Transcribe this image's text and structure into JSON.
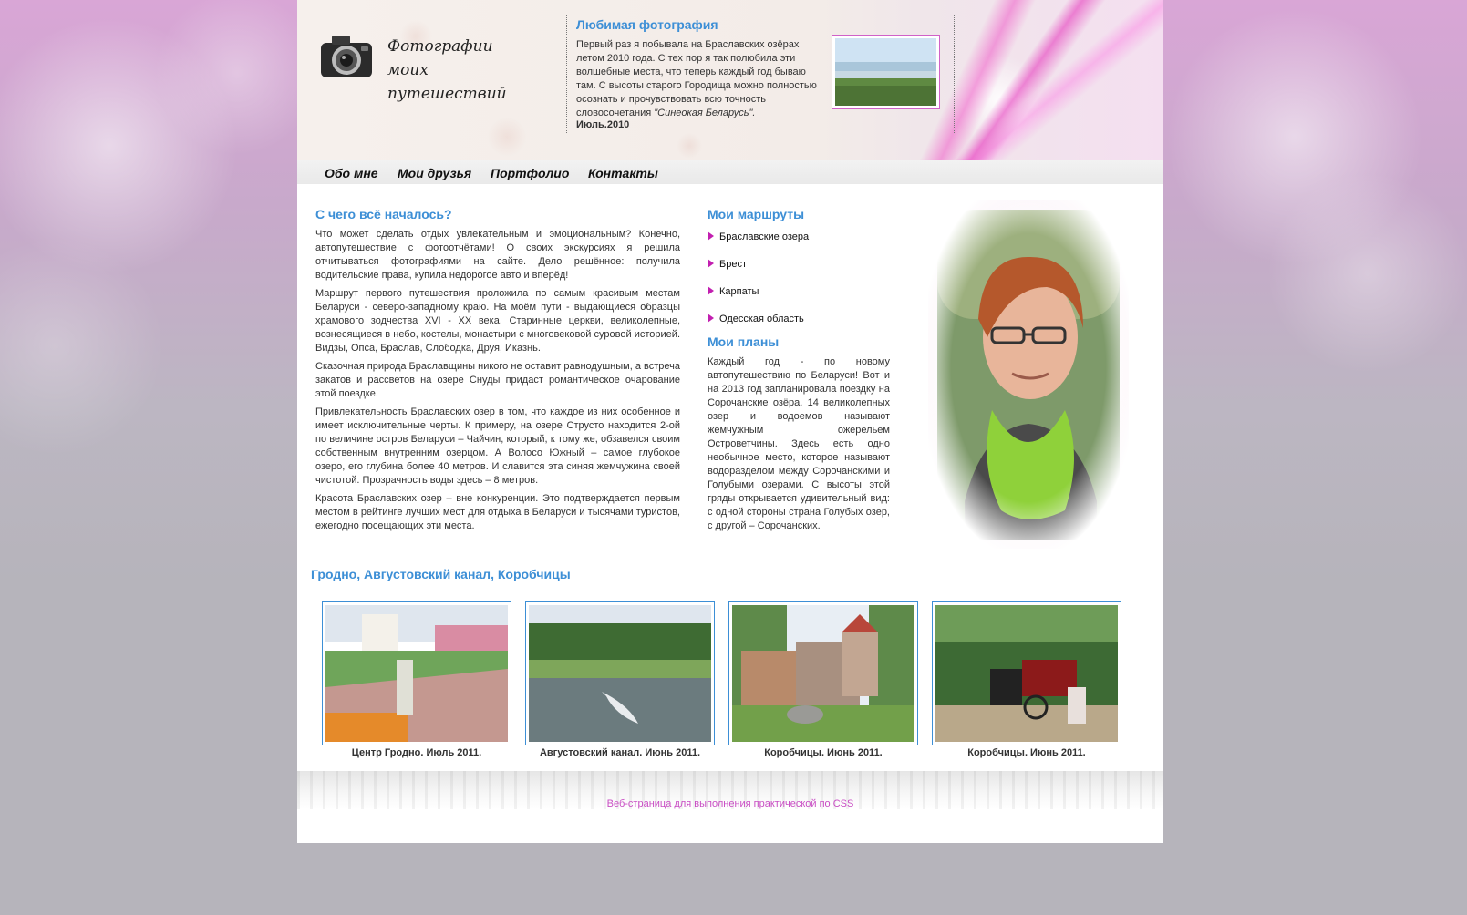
{
  "header": {
    "logo_line1": "Фотографии",
    "logo_line2": "моих путешествий",
    "favorite": {
      "title": "Любимая фотография",
      "text": "Первый раз я побывала на Браславских озёрах летом 2010 года. С тех пор я так полюбила эти волшебные места, что теперь каждый год бываю там. С высоты старого Городища можно полностью осознать и прочувствовать всю точность словосочетания ",
      "quote": "\"Синеокая Беларусь\".",
      "date": "Июль.2010"
    }
  },
  "nav": {
    "items": [
      "Обо мне",
      "Мои друзья",
      "Портфолио",
      "Контакты"
    ]
  },
  "main": {
    "title": "С чего всё началось?",
    "paragraphs": [
      "Что может сделать отдых увлекательным и эмоциональным? Конечно, автопутешествие с фотоотчётами! О своих экскурсиях я решила отчитываться фотографиями на сайте. Дело решённое: получила водительские права, купила недорогое авто и вперёд!",
      "Маршрут первого путешествия проложила по самым красивым местам Беларуси - северо-западному краю. На моём пути - выдающиеся образцы храмового зодчества XVI - XX века. Старинные церкви, великолепные, вознесящиеся в небо, костелы, монастыри с многовековой суровой историей. Видзы, Опса, Браслав, Слободка, Друя, Иказнь.",
      "Сказочная природа Браславщины никого не оставит равнодушным, а встреча закатов и рассветов на озере Снуды придаст романтическое очарование этой поездке.",
      "Привлекательность Браславских озер в том, что каждое из них особенное и имеет исключительные черты. К примеру, на озере Струсто находится 2-ой по величине остров Беларуси – Чайчин, который, к тому же, обзавелся своим собственным внутренним озерцом. А Волосо Южный – самое глубокое озеро, его глубина более 40 метров. И славится эта синяя жемчужина своей чистотой. Прозрачность воды здесь – 8 метров.",
      "Красота Браславских озер – вне конкуренции. Это подтверждается первым местом в рейтинге лучших мест для отдыха в Беларуси и тысячами туристов, ежегодно посещающих эти места."
    ]
  },
  "routes": {
    "title": "Мои маршруты",
    "items": [
      "Браславские озера",
      "Брест",
      "Карпаты",
      "Одесская область"
    ]
  },
  "plans": {
    "title": "Мои планы",
    "text": "Каждый год - по новому автопутешествию по Беларуси! Вот и на 2013 год запланировала поездку на Сорочанские озёра. 14 великолепных озер и водоемов называют жемчужным ожерельем Островетчины. Здесь есть одно необычное место, которое называют водоразделом между Сорочанскими и Голубыми озерами. С высоты этой гряды открывается удивительный вид: с одной стороны страна Голубых озер, с другой – Сорочанских."
  },
  "gallery": {
    "title": "Гродно, Августовский канал, Коробчицы",
    "captions": [
      "Центр Гродно. Июль 2011.",
      "Августовский канал. Июнь 2011.",
      "Коробчицы. Июнь 2011.",
      "Коробчицы. Июнь 2011."
    ]
  },
  "footer": {
    "text": "Веб-страница для выполнения практической по CSS"
  },
  "colors": {
    "accent_blue": "#3d8fd6",
    "accent_magenta": "#c21fb0",
    "footer_pink": "#c94ec4"
  }
}
